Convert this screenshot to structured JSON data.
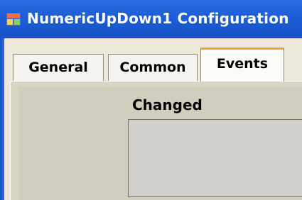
{
  "window": {
    "title": "NumericUpDown1 Configuration",
    "icon": "app-window-icon"
  },
  "tabs": [
    {
      "label": "General",
      "selected": false
    },
    {
      "label": "Common",
      "selected": false
    },
    {
      "label": "Events",
      "selected": true
    }
  ],
  "events": {
    "changed_label": "Changed",
    "changed_value": ""
  },
  "colors": {
    "titlebar": "#1e5fd8",
    "panel": "#d8d5c4",
    "selected_tab_accent": "#f0a23a"
  }
}
